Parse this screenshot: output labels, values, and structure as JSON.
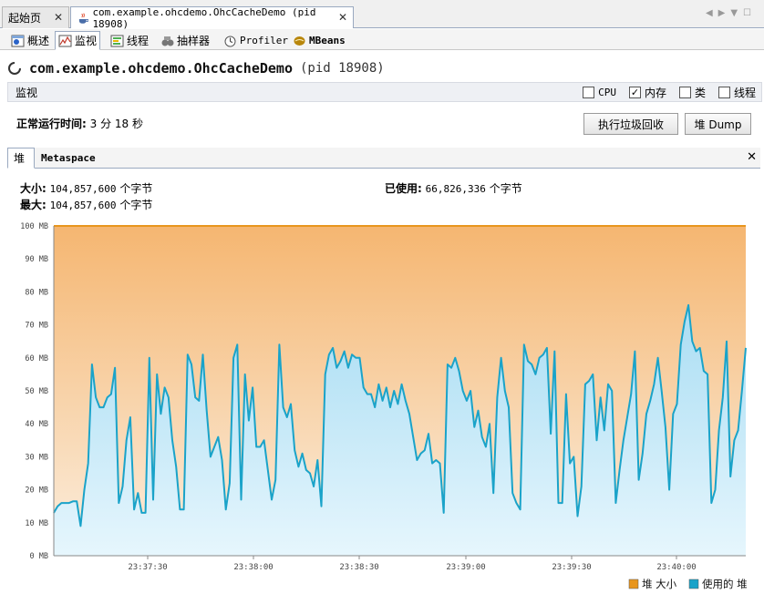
{
  "doc_tabs": [
    {
      "label": "起始页",
      "active": false
    },
    {
      "label": "com.example.ohcdemo.OhcCacheDemo (pid 18908)",
      "active": true
    }
  ],
  "sub_tabs": [
    {
      "label": "概述",
      "icon": "overview-icon"
    },
    {
      "label": "监视",
      "icon": "monitor-icon",
      "active": true
    },
    {
      "label": "线程",
      "icon": "threads-icon"
    },
    {
      "label": "抽样器",
      "icon": "sampler-icon"
    },
    {
      "label": "Profiler",
      "icon": "profiler-icon"
    },
    {
      "label": "MBeans",
      "icon": "mbeans-icon"
    }
  ],
  "title": {
    "main": "com.example.ohcdemo.OhcCacheDemo",
    "pid": "(pid 18908)"
  },
  "monitor": {
    "label": "监视",
    "checkboxes": [
      {
        "label": "CPU",
        "checked": false
      },
      {
        "label": "内存",
        "checked": true
      },
      {
        "label": "类",
        "checked": false
      },
      {
        "label": "线程",
        "checked": false
      }
    ]
  },
  "uptime": {
    "label": "正常运行时间:",
    "value": "3 分 18 秒"
  },
  "buttons": {
    "gc": "执行垃圾回收",
    "dump": "堆 Dump"
  },
  "heap_tabs": {
    "heap": "堆",
    "metaspace": "Metaspace"
  },
  "stats": {
    "size_label": "大小:",
    "size_value": "104,857,600",
    "size_unit": "个字节",
    "max_label": "最大:",
    "max_value": "104,857,600",
    "max_unit": "个字节",
    "used_label": "已使用:",
    "used_value": "66,826,336",
    "used_unit": "个字节"
  },
  "colors": {
    "heap_size": "#e8961e",
    "used_heap": "#1aa3c9"
  },
  "chart_data": {
    "type": "area",
    "ylim": [
      0,
      100
    ],
    "yticks": [
      "0 MB",
      "10 MB",
      "20 MB",
      "30 MB",
      "40 MB",
      "50 MB",
      "60 MB",
      "70 MB",
      "80 MB",
      "90 MB",
      "100 MB"
    ],
    "xticks": [
      "23:37:30",
      "23:38:00",
      "23:38:30",
      "23:39:00",
      "23:39:30",
      "23:40:00"
    ],
    "legend_position": "bottom-right",
    "series": [
      {
        "name": "堆 大小",
        "values_constant": 100
      },
      {
        "name": "使用的 堆",
        "values": [
          13,
          15,
          16,
          16,
          16,
          16.5,
          16.5,
          9,
          20,
          28,
          58,
          48,
          45,
          45,
          48,
          49,
          57,
          16,
          21,
          35,
          42,
          14,
          19,
          13,
          13,
          60,
          17,
          55,
          43,
          51,
          48,
          35,
          27,
          14,
          14,
          61,
          58,
          48,
          47,
          61,
          44,
          30,
          33,
          36,
          29,
          14,
          22,
          60,
          64,
          17,
          55,
          41,
          51,
          33,
          33,
          35,
          26,
          17,
          23,
          64,
          45,
          42,
          46,
          32,
          27,
          31,
          26,
          25,
          21,
          29,
          15,
          55,
          61,
          63,
          57,
          59,
          62,
          57,
          61,
          60,
          60,
          51,
          49,
          49,
          45,
          52,
          47,
          51,
          45,
          50,
          46,
          52,
          47,
          43,
          36,
          29,
          31,
          32,
          37,
          28,
          29,
          28,
          13,
          58,
          57,
          60,
          56,
          50,
          47,
          50,
          39,
          44,
          36,
          33,
          40,
          19,
          48,
          60,
          50,
          45,
          19,
          16,
          14,
          64,
          59,
          58,
          55,
          60,
          61,
          63,
          37,
          62,
          16,
          16,
          49,
          28,
          30,
          12,
          21,
          52,
          53,
          55,
          35,
          48,
          38,
          52,
          50,
          16,
          26,
          35,
          42,
          49,
          62,
          23,
          31,
          43,
          47,
          52,
          60,
          50,
          39,
          20,
          43,
          46,
          64,
          71,
          76,
          65,
          62,
          63,
          56,
          55,
          16,
          20,
          38,
          48,
          65,
          24,
          35,
          38,
          50,
          63
        ]
      }
    ]
  }
}
